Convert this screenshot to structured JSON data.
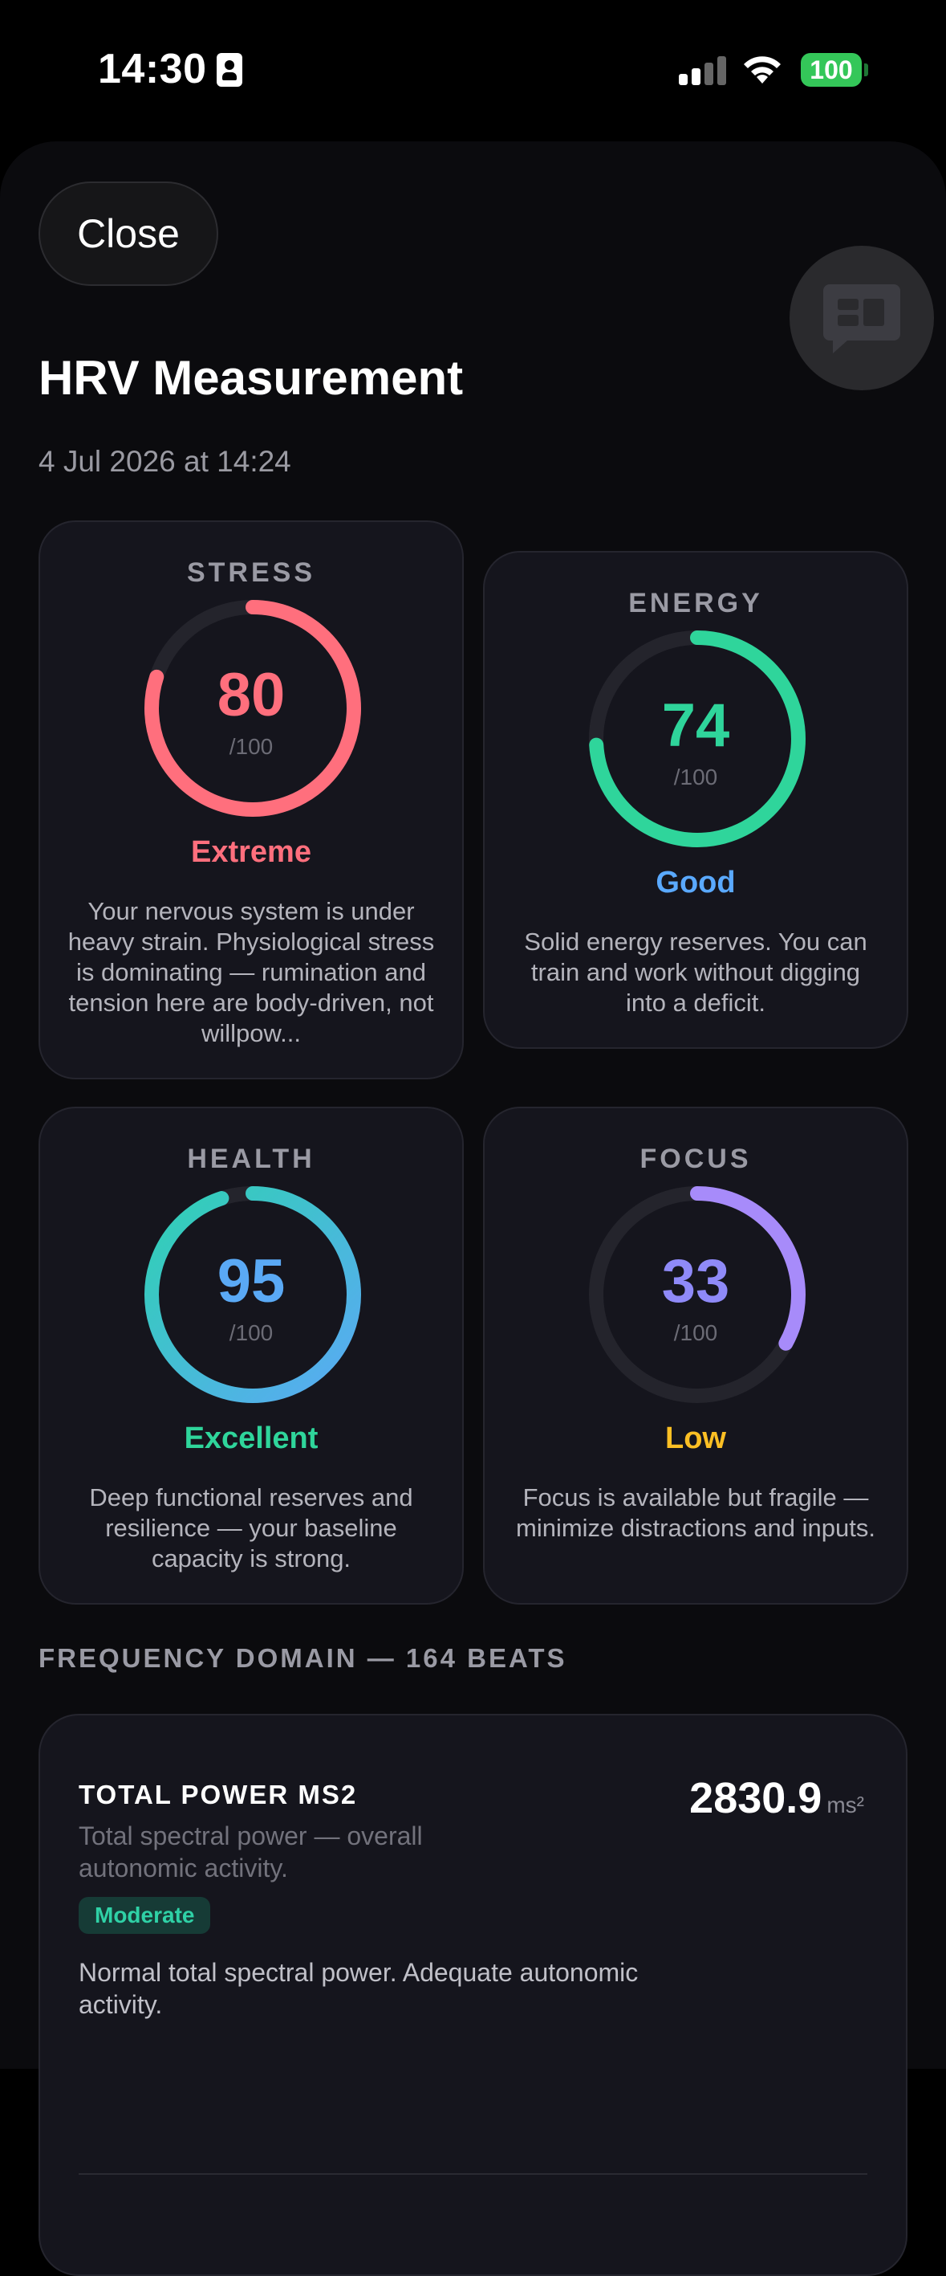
{
  "status_bar": {
    "time": "14:30",
    "battery": "100"
  },
  "header": {
    "close_label": "Close",
    "title": "HRV Measurement",
    "subtitle": "4 Jul 2026 at 14:24"
  },
  "cards": {
    "stress": {
      "label": "STRESS",
      "value": "80",
      "max": "/100",
      "level": "Extreme",
      "description": "Your nervous system is under heavy strain. Physiological stress is dominating — rumination and tension here are body-driven, not willpow...",
      "score": 80,
      "color_start": "#ff6f7d",
      "color_end": "#ff6f7d",
      "level_color": "#ff6f7d"
    },
    "energy": {
      "label": "ENERGY",
      "value": "74",
      "max": "/100",
      "level": "Good",
      "description": "Solid energy reserves. You can train and work without digging into a deficit.",
      "score": 74,
      "color_start": "#2fd59b",
      "color_end": "#2fd59b",
      "level_color": "#5aa9ff"
    },
    "health": {
      "label": "HEALTH",
      "value": "95",
      "max": "/100",
      "level": "Excellent",
      "description": "Deep functional reserves and resilience — your baseline capacity is strong.",
      "score": 95,
      "color_start": "#2fd1b3",
      "color_end": "#5aa9f5",
      "level_color": "#2fd59b",
      "value_color": "#5aa9f5"
    },
    "focus": {
      "label": "FOCUS",
      "value": "33",
      "max": "/100",
      "level": "Low",
      "description": "Focus is available but fragile — minimize distractions and inputs.",
      "score": 33,
      "color_start": "#a78bfa",
      "color_end": "#a78bfa",
      "level_color": "#fbbf24",
      "value_color": "#8f8af8"
    }
  },
  "frequency": {
    "section_title": "FREQUENCY DOMAIN — 164 BEATS",
    "metric": {
      "name": "TOTAL POWER MS2",
      "value": "2830.9",
      "unit": "ms²",
      "hint": "Total spectral power — overall autonomic activity.",
      "tag": "Moderate",
      "note": "Normal total spectral power. Adequate autonomic activity."
    }
  },
  "colors": {
    "track": "#24242c",
    "card_bg": "#15151d"
  }
}
